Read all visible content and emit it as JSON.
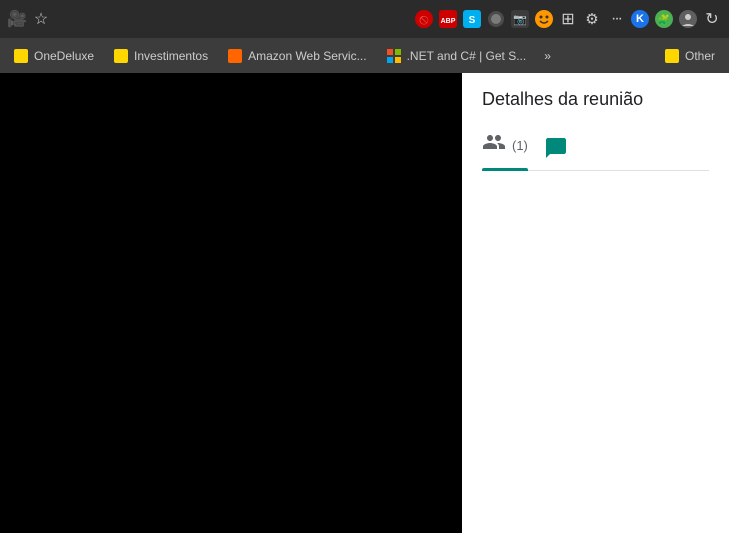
{
  "toolbar": {
    "icons": [
      {
        "name": "camera-icon",
        "symbol": "🎥"
      },
      {
        "name": "star-icon",
        "symbol": "☆"
      },
      {
        "name": "adblock-icon",
        "symbol": "🚫"
      },
      {
        "name": "abp-icon",
        "symbol": "ABP"
      },
      {
        "name": "skype-icon",
        "symbol": "S"
      },
      {
        "name": "circle-icon",
        "symbol": "⬤"
      },
      {
        "name": "photo-icon",
        "symbol": "📷"
      },
      {
        "name": "emoji-icon",
        "symbol": "😊"
      },
      {
        "name": "grid-icon",
        "symbol": "▦"
      },
      {
        "name": "gear-icon",
        "symbol": "⚙"
      },
      {
        "name": "dots-icon",
        "symbol": "···"
      },
      {
        "name": "k-icon",
        "symbol": "K"
      },
      {
        "name": "extension-icon",
        "symbol": "🧩"
      },
      {
        "name": "profile-icon",
        "symbol": "👤"
      },
      {
        "name": "update-icon",
        "symbol": "↻"
      }
    ]
  },
  "tabs": [
    {
      "id": "tab-onedeluxe",
      "label": "OneDeluxe",
      "favicon_color": "#FFD700"
    },
    {
      "id": "tab-investimentos",
      "label": "Investimentos",
      "favicon_color": "#FFD700"
    },
    {
      "id": "tab-aws",
      "label": "Amazon Web Servic...",
      "favicon_color": "#FF6600"
    },
    {
      "id": "tab-dotnet",
      "label": ".NET and C# | Get S...",
      "favicon_color": "#512BD4"
    }
  ],
  "tab_overflow": {
    "symbol": "»"
  },
  "other_tab": {
    "label": "Other",
    "favicon_color": "#FFD700"
  },
  "right_panel": {
    "title": "Detalhes da reunião",
    "tabs": [
      {
        "id": "participants-tab",
        "icon": "people",
        "count": "(1)",
        "active": true
      },
      {
        "id": "chat-tab",
        "icon": "chat",
        "count": "",
        "active": false
      }
    ]
  }
}
